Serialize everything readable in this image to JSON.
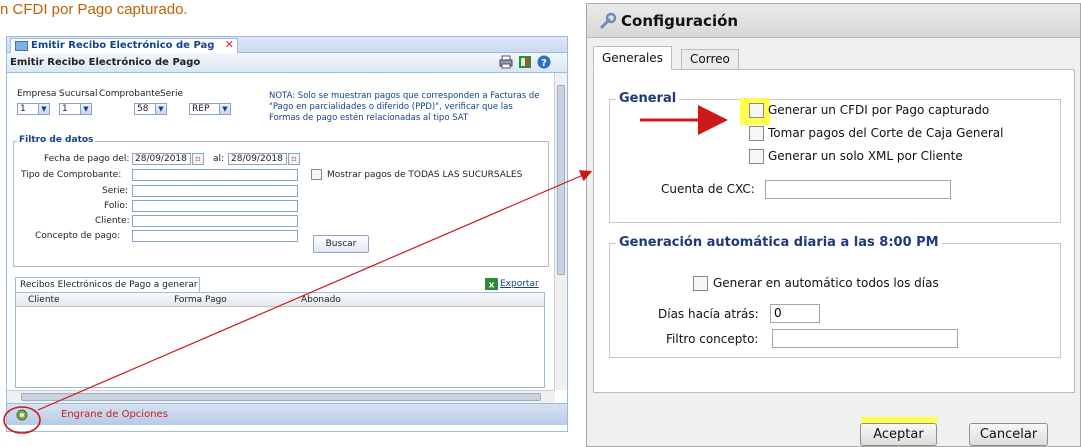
{
  "caption": "n CFDI por Pago capturado.",
  "left": {
    "tab_label": "Emitir Recibo Electrónico de Pag",
    "tab_close": "✕",
    "panel_title": "Emitir Recibo Electrónico de Pago",
    "fields": {
      "empresa_label": "Empresa",
      "empresa_value": "1",
      "sucursal_label": "Sucursal",
      "sucursal_value": "1",
      "comprobante_label": "Comprobante",
      "comprobante_value": "58",
      "serie_label": "Serie",
      "serie_value": "REP"
    },
    "note": [
      "NOTA: Solo se muestran pagos que corresponden a Facturas de",
      "\"Pago en parcialidades o diferido (PPD)\", verificar que las",
      "Formas de pago estén relacionadas al tipo SAT"
    ],
    "filter": {
      "legend": "Filtro de datos",
      "fecha_label": "Fecha de pago del:",
      "fecha_from": "28/09/2018",
      "al_label": "al:",
      "fecha_to": "28/09/2018",
      "tipo_label": "Tipo de Comprobante:",
      "serie_label": "Serie:",
      "folio_label": "Folio:",
      "cliente_label": "Cliente:",
      "concepto_label": "Concepto de pago:",
      "todas_label": "Mostrar pagos de TODAS LAS SUCURSALES",
      "buscar": "Buscar"
    },
    "grid": {
      "tab": "Recibos Electrónicos de Pago a generar",
      "export": "Exportar",
      "columns": [
        "Cliente",
        "Forma Pago",
        "Abonado"
      ]
    },
    "footer_note": "Engrane de Opciones"
  },
  "dialog": {
    "title": "Configuración",
    "tabs": [
      "Generales",
      "Correo"
    ],
    "general": {
      "legend": "General",
      "opt1": "Generar un CFDI por Pago capturado",
      "opt2": "Tomar pagos del Corte de Caja General",
      "opt3": "Generar un solo XML por Cliente",
      "cxc_label": "Cuenta de CXC:",
      "cxc_value": ""
    },
    "auto": {
      "legend": "Generación automática diaria a las 8:00 PM",
      "opt": "Generar en automático todos los días",
      "dias_label": "Días hacía atrás:",
      "dias_value": "0",
      "filtro_label": "Filtro concepto:",
      "filtro_value": ""
    },
    "accept": "Aceptar",
    "cancel": "Cancelar"
  },
  "colors": {
    "annotation_red": "#cc1a1a",
    "highlight": "#ffff3a",
    "accent_blue": "#15428b"
  }
}
